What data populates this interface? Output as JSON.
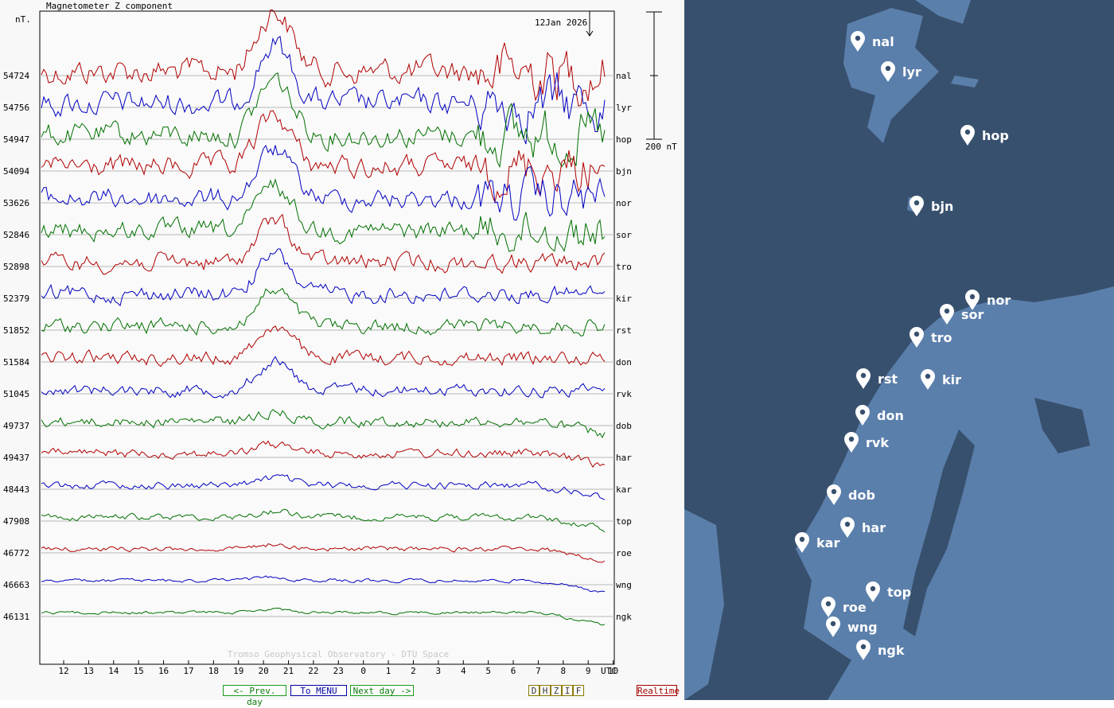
{
  "chart_data": {
    "type": "line",
    "title": "Magnetometer Z component",
    "unit_label": "nT.",
    "date_label": "12Jan 2026",
    "scale_label": "200 nT",
    "x_unit": "UTC",
    "x_ticks": [
      "12",
      "13",
      "14",
      "15",
      "16",
      "17",
      "18",
      "19",
      "20",
      "21",
      "22",
      "23",
      "0",
      "1",
      "2",
      "3",
      "4",
      "5",
      "6",
      "7",
      "8",
      "9",
      "10"
    ],
    "watermark": "Tromso Geophysical Observatory - DTU Space",
    "grid": true,
    "series_colors": [
      "#b00000",
      "#0000c0",
      "#007000"
    ],
    "stations": [
      {
        "code": "nal",
        "baseline": "54724"
      },
      {
        "code": "lyr",
        "baseline": "54756"
      },
      {
        "code": "hop",
        "baseline": "54947"
      },
      {
        "code": "bjn",
        "baseline": "54094"
      },
      {
        "code": "nor",
        "baseline": "53626"
      },
      {
        "code": "sor",
        "baseline": "52846"
      },
      {
        "code": "tro",
        "baseline": "52898"
      },
      {
        "code": "kir",
        "baseline": "52379"
      },
      {
        "code": "rst",
        "baseline": "51852"
      },
      {
        "code": "don",
        "baseline": "51584"
      },
      {
        "code": "rvk",
        "baseline": "51045"
      },
      {
        "code": "dob",
        "baseline": "49737"
      },
      {
        "code": "har",
        "baseline": "49437"
      },
      {
        "code": "kar",
        "baseline": "48443"
      },
      {
        "code": "top",
        "baseline": "47908"
      },
      {
        "code": "roe",
        "baseline": "46772"
      },
      {
        "code": "wng",
        "baseline": "46663"
      },
      {
        "code": "ngk",
        "baseline": "46131"
      }
    ]
  },
  "nav": {
    "prev": "<- Prev. day",
    "menu": "To MENU",
    "next": "Next day ->",
    "components": [
      "D",
      "H",
      "Z",
      "I",
      "F"
    ],
    "realtime": "Realtime"
  },
  "map": {
    "colors": {
      "sea": "#37506d",
      "land": "#5b7fab"
    },
    "markers": [
      "nal",
      "lyr",
      "hop",
      "bjn",
      "nor",
      "sor",
      "tro",
      "rst",
      "kir",
      "don",
      "rvk",
      "dob",
      "har",
      "kar",
      "top",
      "roe",
      "wng",
      "ngk"
    ]
  }
}
